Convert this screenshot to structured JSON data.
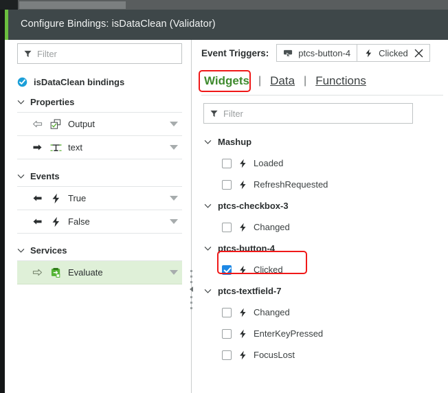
{
  "window": {
    "title": "Configure Bindings: isDataClean (Validator)",
    "accent_color": "#6bbf3f",
    "header_bg": "#3e4749"
  },
  "left_pane": {
    "filter": {
      "placeholder": "Filter",
      "icon": "funnel-icon"
    },
    "bindings_header": {
      "label": "isDataClean bindings",
      "icon": "check-circle-icon"
    },
    "sections": [
      {
        "label": "Properties",
        "rows": [
          {
            "label": "Output",
            "direction_icon": "arrow-left-outline-icon",
            "type_icon": "property-checkbox-icon"
          },
          {
            "label": "text",
            "direction_icon": "arrow-right-solid-icon",
            "type_icon": "text-type-icon"
          }
        ]
      },
      {
        "label": "Events",
        "rows": [
          {
            "label": "True",
            "direction_icon": "arrow-left-solid-icon",
            "type_icon": "lightning-bolt-icon"
          },
          {
            "label": "False",
            "direction_icon": "arrow-left-solid-icon",
            "type_icon": "lightning-bolt-icon"
          }
        ]
      },
      {
        "label": "Services",
        "rows": [
          {
            "label": "Evaluate",
            "direction_icon": "arrow-right-outline-icon",
            "type_icon": "service-icon",
            "highlighted": true
          }
        ]
      }
    ]
  },
  "right_pane": {
    "event_triggers": {
      "label": "Event Triggers:",
      "chips": [
        {
          "label": "ptcs-button-4",
          "icon": "widget-button-icon"
        },
        {
          "label": "Clicked",
          "icon": "lightning-bolt-icon",
          "close_icon": "close-icon"
        }
      ]
    },
    "tabs": [
      {
        "label": "Widgets",
        "active": true,
        "highlighted": true
      },
      {
        "label": "Data",
        "active": false
      },
      {
        "label": "Functions",
        "active": false
      }
    ],
    "tab_separator": "|",
    "filter": {
      "placeholder": "Filter",
      "icon": "funnel-icon"
    },
    "tree": [
      {
        "label": "Mashup",
        "expanded": true,
        "children": [
          {
            "label": "Loaded",
            "checked": false,
            "icon": "lightning-bolt-icon"
          },
          {
            "label": "RefreshRequested",
            "checked": false,
            "icon": "lightning-bolt-icon"
          }
        ]
      },
      {
        "label": "ptcs-checkbox-3",
        "expanded": true,
        "children": [
          {
            "label": "Changed",
            "checked": false,
            "icon": "lightning-bolt-icon"
          }
        ]
      },
      {
        "label": "ptcs-button-4",
        "expanded": true,
        "children": [
          {
            "label": "Clicked",
            "checked": true,
            "icon": "lightning-bolt-icon",
            "highlighted": true
          }
        ]
      },
      {
        "label": "ptcs-textfield-7",
        "expanded": true,
        "children": [
          {
            "label": "Changed",
            "checked": false,
            "icon": "lightning-bolt-icon"
          },
          {
            "label": "EnterKeyPressed",
            "checked": false,
            "icon": "lightning-bolt-icon"
          },
          {
            "label": "FocusLost",
            "checked": false,
            "icon": "lightning-bolt-icon"
          }
        ]
      }
    ]
  },
  "annotations": {
    "color": "#f01818",
    "boxes": [
      "widgets-tab",
      "clicked-checkbox-row"
    ]
  }
}
